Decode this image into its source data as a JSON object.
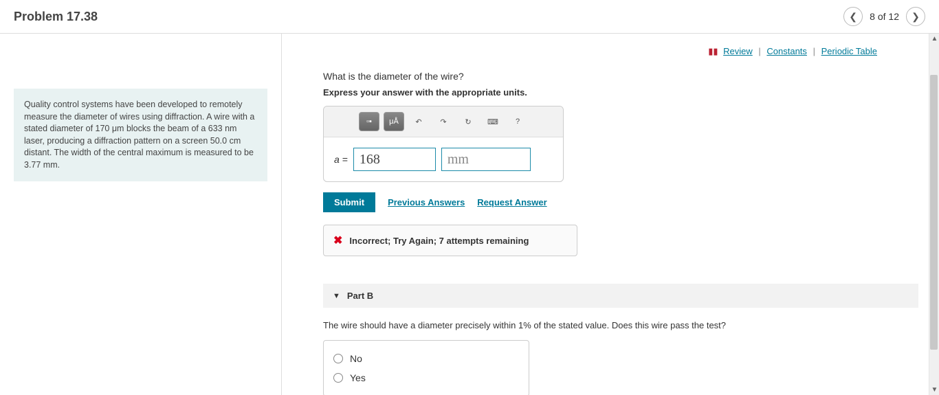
{
  "header": {
    "title": "Problem 17.38",
    "pager_text": "8 of 12"
  },
  "top_links": {
    "review": "Review",
    "constants": "Constants",
    "periodic": "Periodic Table"
  },
  "context": {
    "text": "Quality control systems have been developed to remotely measure the diameter of wires using diffraction. A wire with a stated diameter of 170 μm blocks the beam of a 633 nm laser, producing a diffraction pattern on a screen 50.0 cm distant. The width of the central maximum is measured to be 3.77 mm."
  },
  "partA": {
    "question": "What is the diameter of the wire?",
    "instruction": "Express your answer with the appropriate units.",
    "var_label": "a =",
    "value": "168",
    "unit": "mm",
    "tool_units": "μÅ",
    "tool_help": "?",
    "submit": "Submit",
    "prev_answers": "Previous Answers",
    "request_answer": "Request Answer",
    "feedback": "Incorrect; Try Again; 7 attempts remaining"
  },
  "partB": {
    "label": "Part B",
    "question": "The wire should have a diameter precisely within 1% of the stated value. Does this wire pass the test?",
    "choices": [
      "No",
      "Yes"
    ]
  }
}
